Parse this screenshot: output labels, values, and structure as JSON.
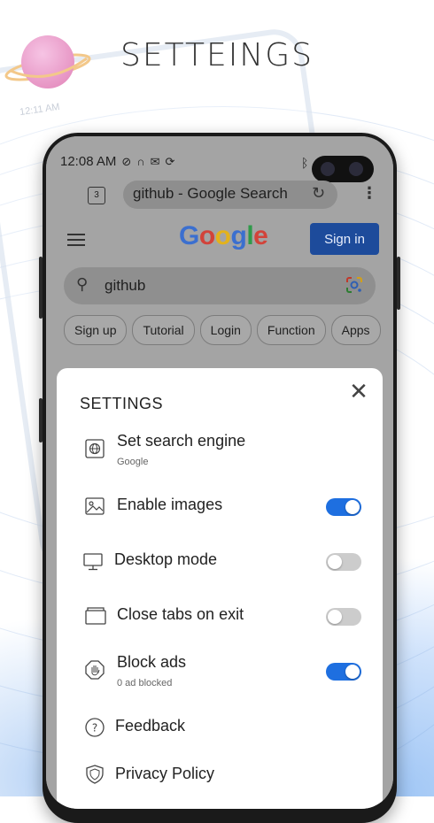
{
  "title": "SETTEINGS",
  "ghost_status": "12:11 AM",
  "status_bar": {
    "time": "12:08 AM"
  },
  "browser": {
    "tab_count": "3",
    "url_text": "github - Google Search"
  },
  "google": {
    "logo_letters": [
      "G",
      "o",
      "o",
      "g",
      "l",
      "e"
    ],
    "logo_colors": [
      "#3b6fcf",
      "#d2433a",
      "#e3b21c",
      "#3b6fcf",
      "#2f9a4a",
      "#d2433a"
    ],
    "sign_in_label": "Sign in",
    "search_query": "github",
    "chips": [
      "Sign up",
      "Tutorial",
      "Login",
      "Function",
      "Apps"
    ]
  },
  "settings": {
    "title": "SETTINGS",
    "items": [
      {
        "label": "Set search engine",
        "sub": "Google",
        "icon": "globe-icon"
      },
      {
        "label": "Enable images",
        "toggle": true,
        "icon": "image-icon"
      },
      {
        "label": "Desktop mode",
        "toggle": false,
        "icon": "monitor-icon"
      },
      {
        "label": "Close tabs on exit",
        "toggle": false,
        "icon": "tabs-icon"
      },
      {
        "label": "Block ads",
        "sub": "0 ad blocked",
        "toggle": true,
        "icon": "hand-stop-icon"
      },
      {
        "label": "Feedback",
        "icon": "question-icon"
      },
      {
        "label": "Privacy Policy",
        "icon": "shield-icon"
      }
    ]
  },
  "colors": {
    "accent": "#1e6fe0",
    "toggle_off": "#cccccc"
  }
}
